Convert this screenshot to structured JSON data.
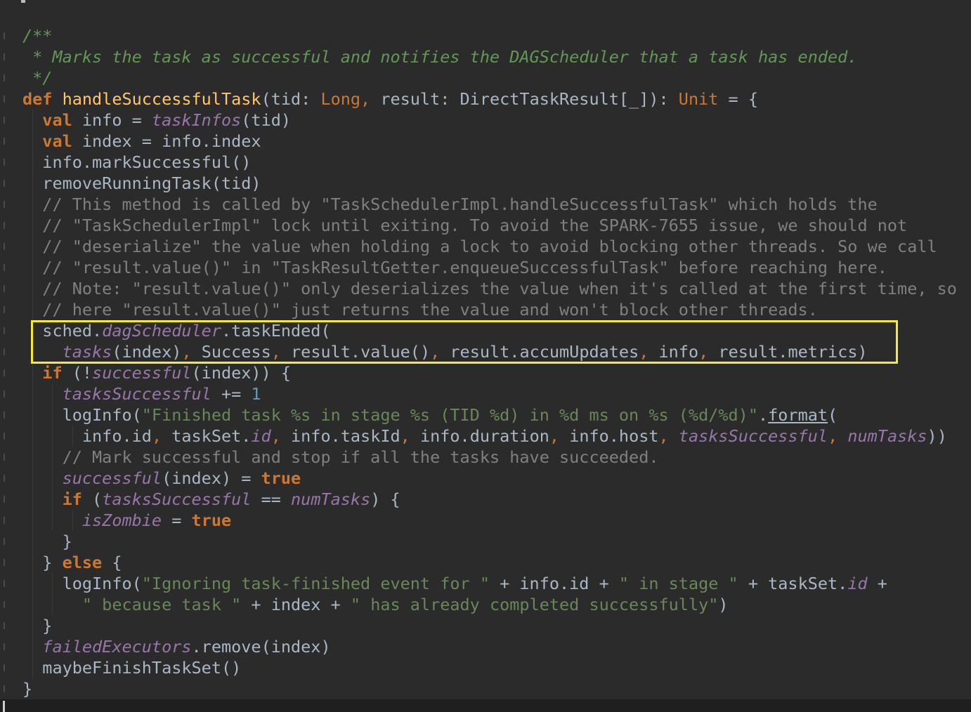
{
  "editor": {
    "colors": {
      "background": "#2b2b2b",
      "default_text": "#a9b7c6",
      "doc_comment": "#629755",
      "line_comment": "#808080",
      "keyword": "#cc7832",
      "method_declaration": "#ffc66d",
      "field": "#9876aa",
      "string": "#6a8759",
      "number": "#6897bb",
      "highlight_box": "#f6eb2e"
    },
    "lines": [
      [
        {
          "t": "doc",
          "v": "/**"
        }
      ],
      [
        {
          "t": "doc",
          "v": " * Marks the task as successful and notifies the DAGScheduler that a task has ended."
        }
      ],
      [
        {
          "t": "doc",
          "v": " */"
        }
      ],
      [
        {
          "t": "kw",
          "v": "def "
        },
        {
          "t": "fn",
          "v": "handleSuccessfulTask"
        },
        {
          "t": "id",
          "v": "(tid: "
        },
        {
          "t": "kwp",
          "v": "Long, "
        },
        {
          "t": "id",
          "v": "result: DirectTaskResult[_]): "
        },
        {
          "t": "kwp",
          "v": "Unit"
        },
        {
          "t": "id",
          "v": " = {"
        }
      ],
      [
        {
          "t": "id",
          "v": "  "
        },
        {
          "t": "kw",
          "v": "val "
        },
        {
          "t": "id",
          "v": "info = "
        },
        {
          "t": "fld",
          "v": "taskInfos"
        },
        {
          "t": "id",
          "v": "(tid)"
        }
      ],
      [
        {
          "t": "id",
          "v": "  "
        },
        {
          "t": "kw",
          "v": "val "
        },
        {
          "t": "id",
          "v": "index = info.index"
        }
      ],
      [
        {
          "t": "id",
          "v": "  info.markSuccessful()"
        }
      ],
      [
        {
          "t": "id",
          "v": "  removeRunningTask(tid)"
        }
      ],
      [
        {
          "t": "cmt",
          "v": "  // This method is called by \"TaskSchedulerImpl.handleSuccessfulTask\" which holds the"
        }
      ],
      [
        {
          "t": "cmt",
          "v": "  // \"TaskSchedulerImpl\" lock until exiting. To avoid the SPARK-7655 issue, we should not"
        }
      ],
      [
        {
          "t": "cmt",
          "v": "  // \"deserialize\" the value when holding a lock to avoid blocking other threads. So we call"
        }
      ],
      [
        {
          "t": "cmt",
          "v": "  // \"result.value()\" in \"TaskResultGetter.enqueueSuccessfulTask\" before reaching here."
        }
      ],
      [
        {
          "t": "cmt",
          "v": "  // Note: \"result.value()\" only deserializes the value when it's called at the first time, so"
        }
      ],
      [
        {
          "t": "cmt",
          "v": "  // here \"result.value()\" just returns the value and won't block other threads."
        }
      ],
      [
        {
          "t": "id",
          "v": "  sched."
        },
        {
          "t": "fld",
          "v": "dagScheduler"
        },
        {
          "t": "id",
          "v": ".taskEnded("
        }
      ],
      [
        {
          "t": "id",
          "v": "    "
        },
        {
          "t": "fld",
          "v": "tasks"
        },
        {
          "t": "id",
          "v": "(index)"
        },
        {
          "t": "kwp",
          "v": ", "
        },
        {
          "t": "id",
          "v": "Success"
        },
        {
          "t": "kwp",
          "v": ", "
        },
        {
          "t": "id",
          "v": "result.value()"
        },
        {
          "t": "kwp",
          "v": ", "
        },
        {
          "t": "id",
          "v": "result.accumUpdates"
        },
        {
          "t": "kwp",
          "v": ", "
        },
        {
          "t": "id",
          "v": "info"
        },
        {
          "t": "kwp",
          "v": ", "
        },
        {
          "t": "id",
          "v": "result.metrics)"
        }
      ],
      [
        {
          "t": "id",
          "v": "  "
        },
        {
          "t": "kw",
          "v": "if "
        },
        {
          "t": "id",
          "v": "(!"
        },
        {
          "t": "fld",
          "v": "successful"
        },
        {
          "t": "id",
          "v": "(index)) {"
        }
      ],
      [
        {
          "t": "id",
          "v": "    "
        },
        {
          "t": "fld",
          "v": "tasksSuccessful"
        },
        {
          "t": "id",
          "v": " += "
        },
        {
          "t": "num",
          "v": "1"
        }
      ],
      [
        {
          "t": "id",
          "v": "    logInfo("
        },
        {
          "t": "str",
          "v": "\"Finished task %s in stage %s (TID %d) in %d ms on %s (%d/%d)\""
        },
        {
          "t": "id",
          "v": "."
        },
        {
          "t": "ul",
          "v": "format"
        },
        {
          "t": "id",
          "v": "("
        }
      ],
      [
        {
          "t": "id",
          "v": "      info.id"
        },
        {
          "t": "kwp",
          "v": ", "
        },
        {
          "t": "id",
          "v": "taskSet."
        },
        {
          "t": "fld",
          "v": "id"
        },
        {
          "t": "kwp",
          "v": ", "
        },
        {
          "t": "id",
          "v": "info.taskId"
        },
        {
          "t": "kwp",
          "v": ", "
        },
        {
          "t": "id",
          "v": "info.duration"
        },
        {
          "t": "kwp",
          "v": ", "
        },
        {
          "t": "id",
          "v": "info.host"
        },
        {
          "t": "kwp",
          "v": ", "
        },
        {
          "t": "fld",
          "v": "tasksSuccessful"
        },
        {
          "t": "kwp",
          "v": ", "
        },
        {
          "t": "fld",
          "v": "numTasks"
        },
        {
          "t": "id",
          "v": "))"
        }
      ],
      [
        {
          "t": "cmt",
          "v": "    // Mark successful and stop if all the tasks have succeeded."
        }
      ],
      [
        {
          "t": "id",
          "v": "    "
        },
        {
          "t": "fld",
          "v": "successful"
        },
        {
          "t": "id",
          "v": "(index) = "
        },
        {
          "t": "kw",
          "v": "true"
        }
      ],
      [
        {
          "t": "id",
          "v": "    "
        },
        {
          "t": "kw",
          "v": "if "
        },
        {
          "t": "id",
          "v": "("
        },
        {
          "t": "fld",
          "v": "tasksSuccessful"
        },
        {
          "t": "id",
          "v": " == "
        },
        {
          "t": "fld",
          "v": "numTasks"
        },
        {
          "t": "id",
          "v": ") {"
        }
      ],
      [
        {
          "t": "id",
          "v": "      "
        },
        {
          "t": "fld",
          "v": "isZombie"
        },
        {
          "t": "id",
          "v": " = "
        },
        {
          "t": "kw",
          "v": "true"
        }
      ],
      [
        {
          "t": "id",
          "v": "    }"
        }
      ],
      [
        {
          "t": "id",
          "v": "  } "
        },
        {
          "t": "kw",
          "v": "else "
        },
        {
          "t": "id",
          "v": "{"
        }
      ],
      [
        {
          "t": "id",
          "v": "    logInfo("
        },
        {
          "t": "str",
          "v": "\"Ignoring task-finished event for \""
        },
        {
          "t": "id",
          "v": " + info.id + "
        },
        {
          "t": "str",
          "v": "\" in stage \""
        },
        {
          "t": "id",
          "v": " + taskSet."
        },
        {
          "t": "fld",
          "v": "id"
        },
        {
          "t": "id",
          "v": " +"
        }
      ],
      [
        {
          "t": "id",
          "v": "      "
        },
        {
          "t": "str",
          "v": "\" because task \""
        },
        {
          "t": "id",
          "v": " + index + "
        },
        {
          "t": "str",
          "v": "\" has already completed successfully\""
        },
        {
          "t": "id",
          "v": ")"
        }
      ],
      [
        {
          "t": "id",
          "v": "  }"
        }
      ],
      [
        {
          "t": "id",
          "v": "  "
        },
        {
          "t": "fld",
          "v": "failedExecutors"
        },
        {
          "t": "id",
          "v": ".remove(index)"
        }
      ],
      [
        {
          "t": "id",
          "v": "  maybeFinishTaskSet()"
        }
      ],
      [
        {
          "t": "id",
          "v": "}"
        }
      ]
    ]
  }
}
